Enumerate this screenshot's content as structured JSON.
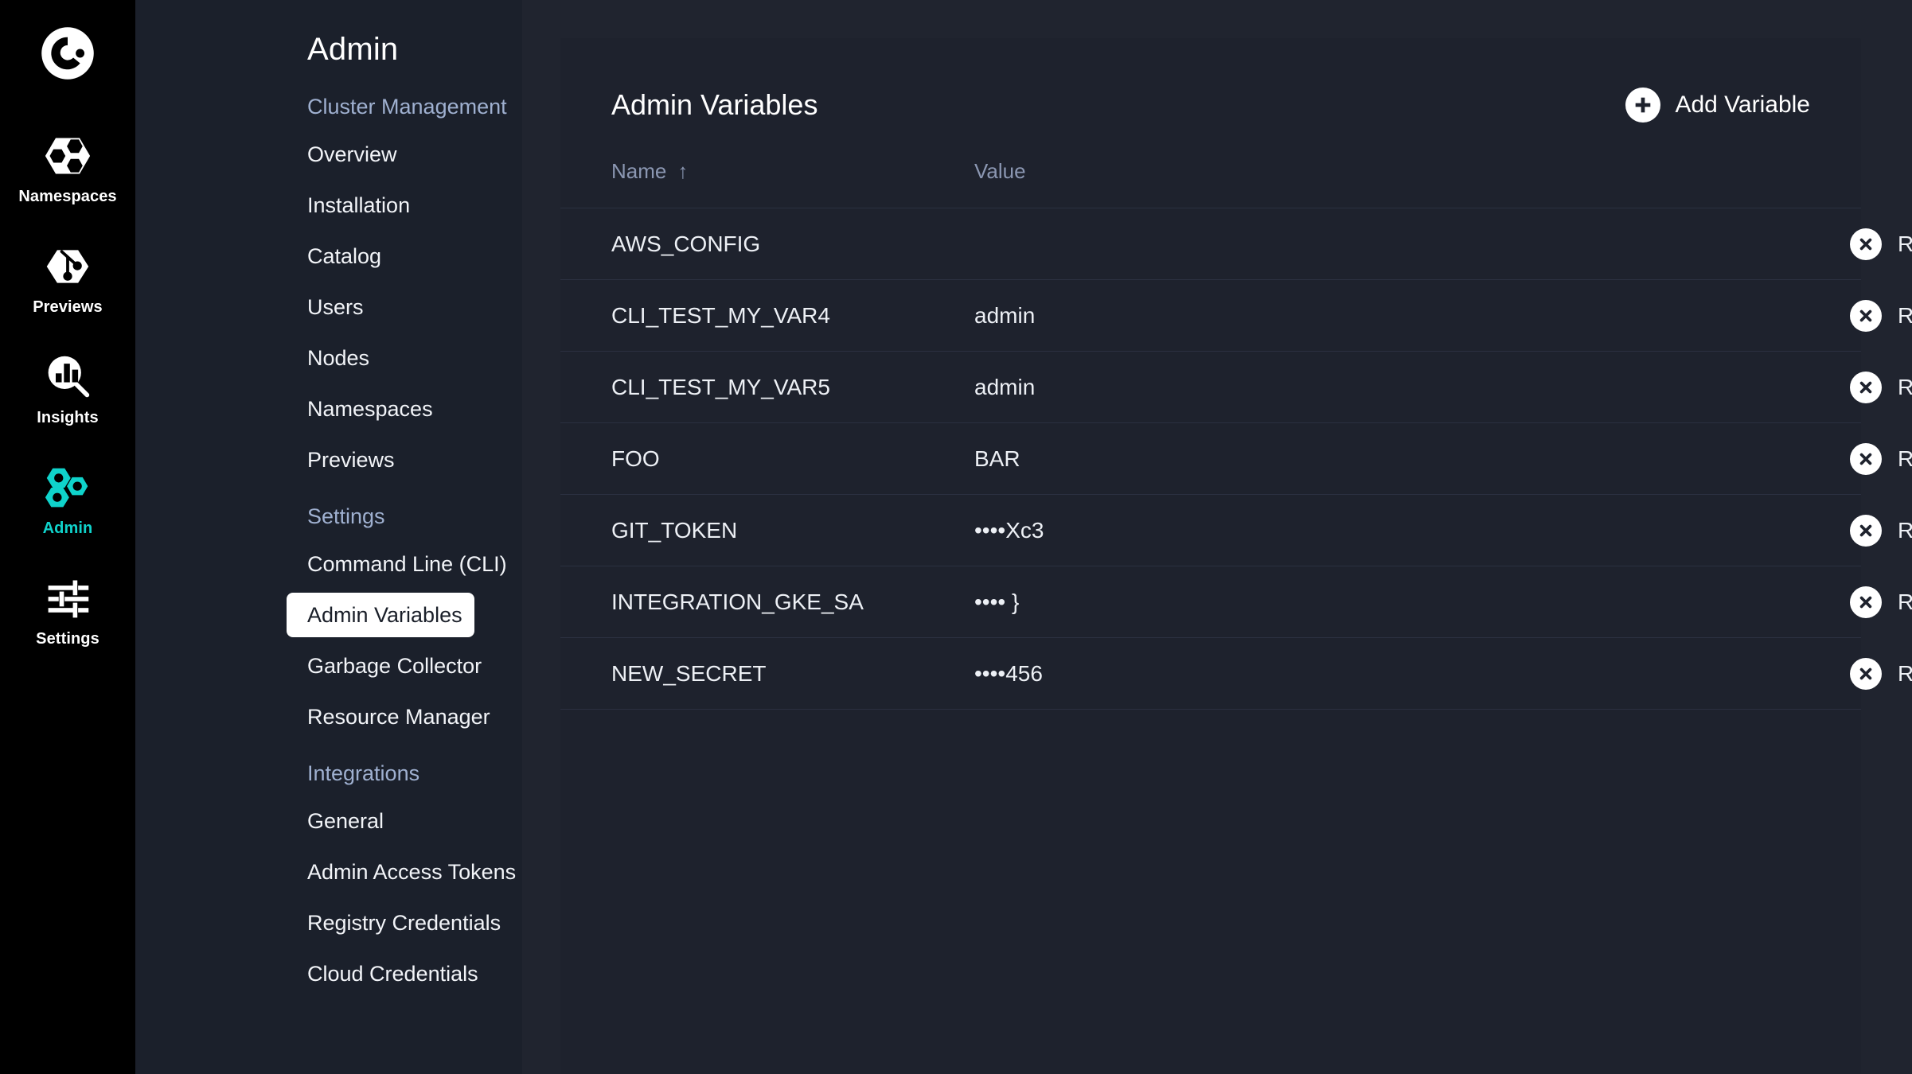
{
  "rail": {
    "logo_icon": "crucible-logo-icon",
    "items": [
      {
        "label": "Namespaces",
        "icon": "hexagon-cluster-icon",
        "active": false
      },
      {
        "label": "Previews",
        "icon": "git-branch-hexagon-icon",
        "active": false
      },
      {
        "label": "Insights",
        "icon": "chart-magnifier-icon",
        "active": false
      },
      {
        "label": "Admin",
        "icon": "hexagon-nodes-icon",
        "active": true
      },
      {
        "label": "Settings",
        "icon": "sliders-icon",
        "active": false
      }
    ],
    "active_color": "#0fd3cb"
  },
  "nav": {
    "title": "Admin",
    "groups": [
      {
        "title": "Cluster Management",
        "items": [
          {
            "label": "Overview",
            "selected": false
          },
          {
            "label": "Installation",
            "selected": false
          },
          {
            "label": "Catalog",
            "selected": false
          },
          {
            "label": "Users",
            "selected": false
          },
          {
            "label": "Nodes",
            "selected": false
          },
          {
            "label": "Namespaces",
            "selected": false
          },
          {
            "label": "Previews",
            "selected": false
          }
        ]
      },
      {
        "title": "Settings",
        "items": [
          {
            "label": "Command Line (CLI)",
            "selected": false
          },
          {
            "label": "Admin Variables",
            "selected": true
          },
          {
            "label": "Garbage Collector",
            "selected": false
          },
          {
            "label": "Resource Manager",
            "selected": false
          }
        ]
      },
      {
        "title": "Integrations",
        "items": [
          {
            "label": "General",
            "selected": false
          },
          {
            "label": "Admin Access Tokens",
            "selected": false
          },
          {
            "label": "Registry Credentials",
            "selected": false
          },
          {
            "label": "Cloud Credentials",
            "selected": false
          }
        ]
      }
    ]
  },
  "panel": {
    "title": "Admin Variables",
    "add_button": {
      "label": "Add Variable",
      "icon": "plus-circle-icon"
    },
    "columns": {
      "name": "Name",
      "value": "Value",
      "sort_arrow": "↑"
    },
    "remove_label": "Remove",
    "remove_icon": "x-circle-icon",
    "rows": [
      {
        "name": "AWS_CONFIG",
        "value": ""
      },
      {
        "name": "CLI_TEST_MY_VAR4",
        "value": "admin"
      },
      {
        "name": "CLI_TEST_MY_VAR5",
        "value": "admin"
      },
      {
        "name": "FOO",
        "value": "BAR"
      },
      {
        "name": "GIT_TOKEN",
        "value": "••••Xc3"
      },
      {
        "name": "INTEGRATION_GKE_SA",
        "value": "•••• }"
      },
      {
        "name": "NEW_SECRET",
        "value": "••••456"
      }
    ]
  }
}
